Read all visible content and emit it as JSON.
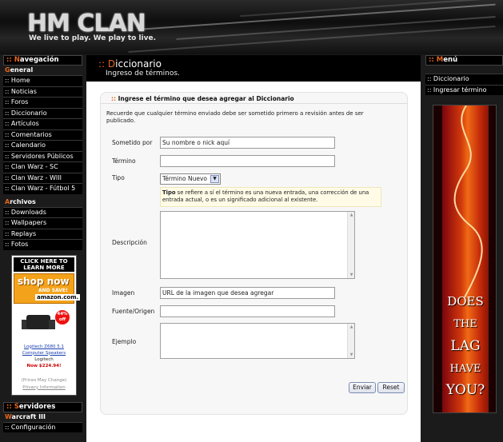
{
  "header": {
    "logo": "HM CLAN",
    "tagline": "We live to play. We play to live."
  },
  "left": {
    "nav_title_prefix": "::",
    "nav_title_first": "N",
    "nav_title_rest": "avegación",
    "general_first": "G",
    "general_rest": "eneral",
    "general_items": [
      ":: Home",
      ":: Noticias",
      ":: Foros",
      ":: Diccionario",
      ":: Artículos",
      ":: Comentarios",
      ":: Calendario",
      ":: Servidores Públicos",
      ":: Clan Warz - SC",
      ":: Clan Warz - WIII",
      ":: Clan Warz - Fútbol 5"
    ],
    "archivos_first": "A",
    "archivos_rest": "rchivos",
    "archivos_items": [
      ":: Downloads",
      ":: Wallpapers",
      ":: Replays",
      ":: Fotos"
    ],
    "ad": {
      "click_here": "CLICK HERE TO LEARN MORE",
      "shop_now": "shop now",
      "and_save": "AND SAVE!",
      "amazon": "amazon.com.",
      "off_badge": "44% off",
      "product_link": "Logitech Z680 5.1 Computer Speakers",
      "brand": "Logitech",
      "price": "Now $224.94!",
      "prices_may_change": "(Prices May Change)",
      "privacy": "Privacy Information"
    },
    "servers_title_prefix": "::",
    "servers_title_first": "S",
    "servers_title_rest": "ervidores",
    "warcraft_first": "W",
    "warcraft_rest": "arcraft III",
    "warcraft_items": [
      ":: Configuración"
    ]
  },
  "center": {
    "title_prefix": "::",
    "title_first": "D",
    "title_rest": "iccionario",
    "subtitle": "Ingreso de términos.",
    "panel_title_prefix": "::",
    "panel_title": "Ingrese el término que desea agregar al Diccionario",
    "note": "Recuerde que cualquier término enviado debe ser sometido primero a revisión antes de ser publicado.",
    "fields": {
      "submitted_by_label": "Sometido por",
      "submitted_by_value": "Su nombre o nick aquí",
      "term_label": "Término",
      "term_value": "",
      "type_label": "Tipo",
      "type_value": "Término Nuevo",
      "type_help_bold": "Tipo",
      "type_help": " se refiere a sí el término es una nueva entrada, una corrección de una entrada actual, o es un significado adicional al existente.",
      "description_label": "Descripción",
      "image_label": "Imagen",
      "image_value": "URL de la imagen que desea agregar",
      "source_label": "Fuente/Origen",
      "source_value": "",
      "example_label": "Ejemplo"
    },
    "buttons": {
      "submit": "Enviar",
      "reset": "Reset"
    }
  },
  "right": {
    "menu_title_prefix": "::",
    "menu_title_first": "M",
    "menu_title_rest": "enú",
    "items": [
      ":: Diccionario",
      ":: Ingresar término"
    ],
    "banner_words": [
      "DOES",
      "THE",
      "LAG",
      "HAVE",
      "YOU?"
    ]
  },
  "colors": {
    "accent": "#e8651c",
    "background": "#1b1b1b",
    "panel": "#f7f7f7"
  }
}
